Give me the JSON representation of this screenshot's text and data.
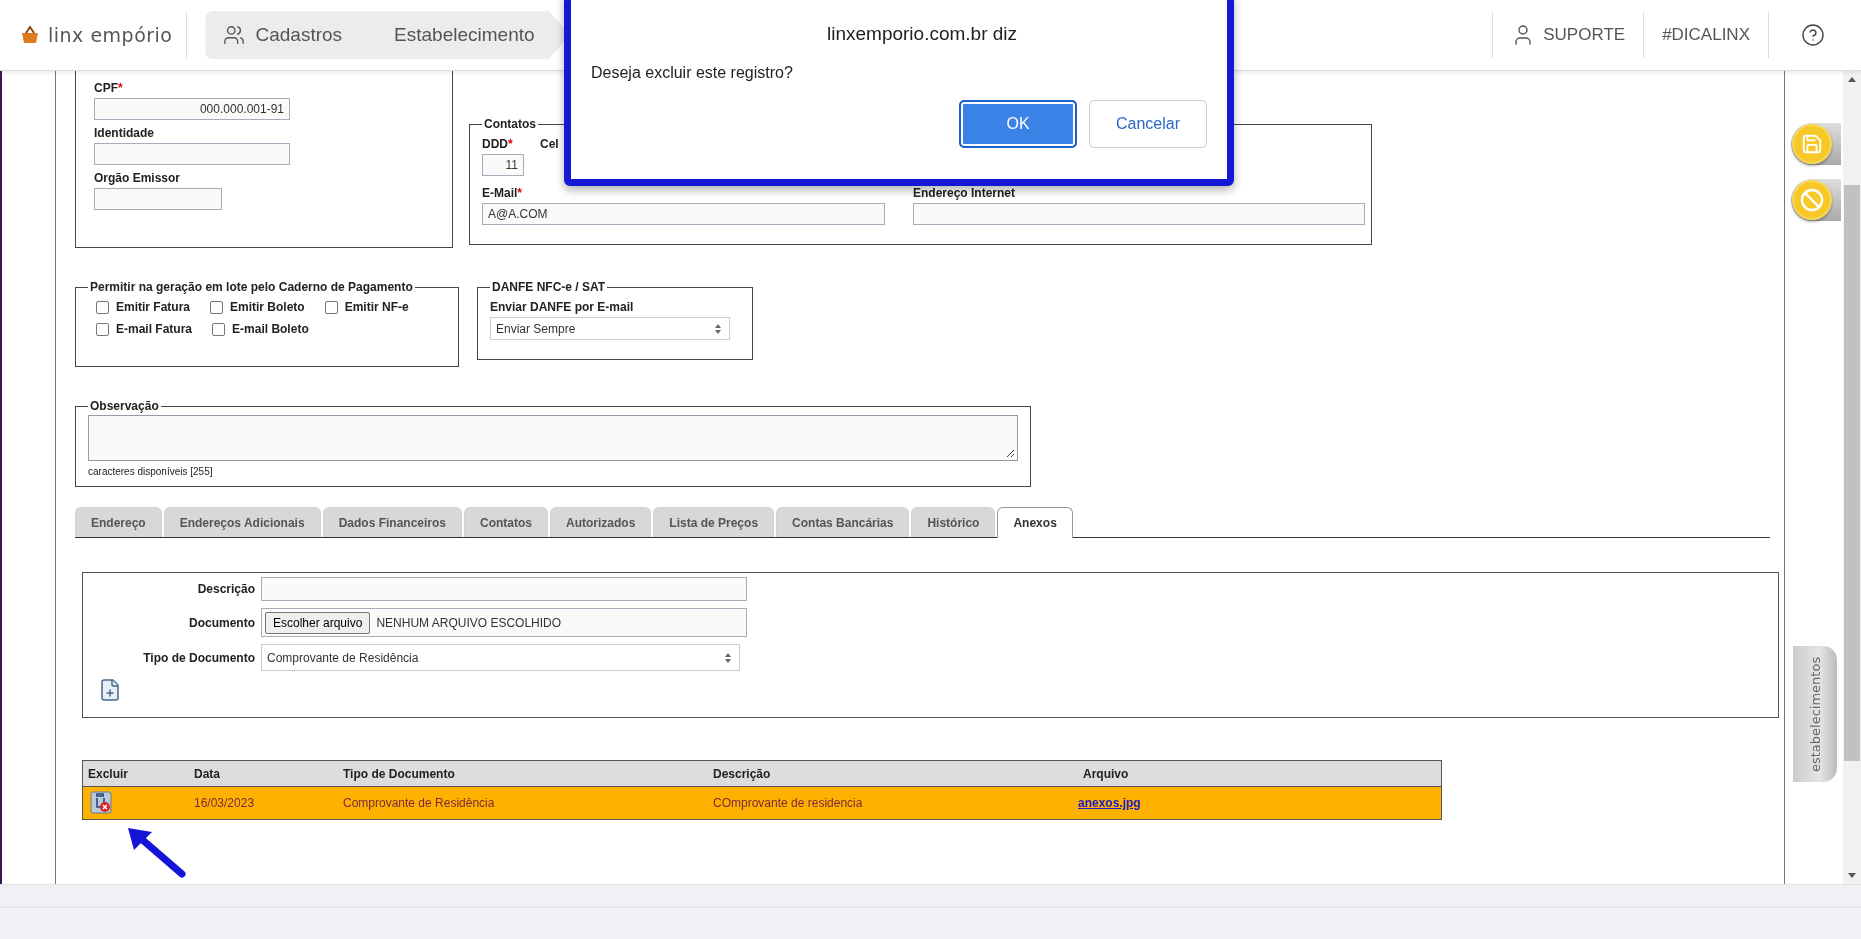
{
  "header": {
    "logo": "linx empório",
    "breadcrumb": [
      {
        "label": "Cadastros",
        "kind": "people"
      },
      {
        "label": "Estabelecimento",
        "kind": "plain"
      }
    ],
    "links": [
      {
        "label": "SUPORTE",
        "kind": "user"
      },
      {
        "label": "#DICALINX",
        "kind": "plain"
      }
    ]
  },
  "identity": {
    "fields": [
      {
        "label": "CPF",
        "required_mark": "*",
        "value": "000.000.001-91"
      },
      {
        "label": "Identidade"
      },
      {
        "label": "Orgão Emissor"
      }
    ]
  },
  "contacts": {
    "legend": "Contatos",
    "ddd": {
      "label": "DDD",
      "required_mark": "*",
      "value": "11"
    },
    "cell_label": "Cel",
    "email": {
      "label": "E-Mail",
      "required_mark": "*",
      "value": "A@A.COM"
    },
    "website": {
      "label": "Endereço Internet"
    }
  },
  "batch": {
    "legend": "Permitir na geração em lote pelo Caderno de Pagamento",
    "rows": [
      [
        {
          "label": "Emitir Fatura",
          "checked": false
        },
        {
          "label": "Emitir Boleto",
          "checked": false
        },
        {
          "label": "Emitir NF-e",
          "checked": false
        }
      ],
      [
        {
          "label": "E-mail Fatura",
          "checked": false
        },
        {
          "label": "E-mail Boleto",
          "checked": false
        }
      ]
    ]
  },
  "danfe": {
    "legend": "DANFE NFC-e / SAT",
    "label": "Enviar DANFE por E-mail",
    "value": "Enviar Sempre"
  },
  "notes": {
    "legend": "Observação",
    "counter": "caracteres disponíveis [255]"
  },
  "tabs": [
    {
      "label": "Endereço",
      "selected": false
    },
    {
      "label": "Endereços Adicionais",
      "selected": false
    },
    {
      "label": "Dados Financeiros",
      "selected": false
    },
    {
      "label": "Contatos",
      "selected": false
    },
    {
      "label": "Autorizados",
      "selected": false
    },
    {
      "label": "Lista de Preços",
      "selected": false
    },
    {
      "label": "Contas Bancárias",
      "selected": false
    },
    {
      "label": "Histórico",
      "selected": false
    },
    {
      "label": "Anexos",
      "selected": true
    }
  ],
  "attachment_form": {
    "fields": [
      {
        "kind": "text",
        "label": "Descrição"
      },
      {
        "kind": "file",
        "label": "Documento",
        "button": "Escolher arquivo",
        "value": "NENHUM ARQUIVO ESCOLHIDO"
      },
      {
        "kind": "select",
        "label": "Tipo de Documento",
        "value": "Comprovante de Residência"
      }
    ]
  },
  "attachments_table": {
    "columns": [
      "Excluir",
      "Data",
      "Tipo de Documento",
      "Descrição",
      "Arquivo"
    ],
    "rows": [
      {
        "selected": true,
        "date": "16/03/2023",
        "type": "Comprovante de Residência",
        "description": "COmprovante de residencia",
        "file": "anexos.jpg"
      }
    ]
  },
  "side_tab": "estabelecimentos",
  "dialog": {
    "title": "linxemporio.com.br diz",
    "message": "Deseja excluir este registro?",
    "buttons": [
      {
        "label": "OK",
        "primary": true
      },
      {
        "label": "Cancelar",
        "primary": false
      }
    ]
  }
}
